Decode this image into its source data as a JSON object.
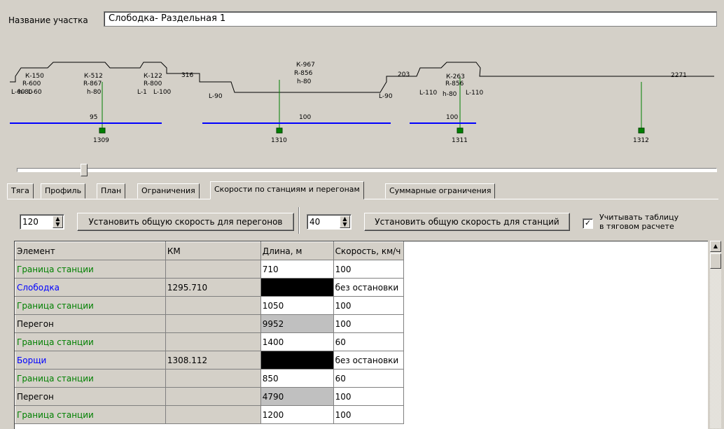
{
  "header": {
    "label": "Название участка",
    "value": "Слободка- Раздельная 1"
  },
  "scheme": {
    "group1": {
      "k": "К-150",
      "r": "R-600",
      "l": "L-60",
      "h": "h-80",
      "l2": "L-60"
    },
    "group2": {
      "k": "К-512",
      "r": "R-867",
      "h": "h-80"
    },
    "group3": {
      "k": "К-122",
      "r": "R-800",
      "l": "L-1",
      "l2": "L-100"
    },
    "len316": "316",
    "l90a": "L-90",
    "group4": {
      "k": "К-967",
      "r": "R-856",
      "h": "h-80"
    },
    "l90b": "L-90",
    "len203": "203",
    "group5": {
      "k": "К-263",
      "r": "R-856",
      "l": "L-110",
      "h": "h-80",
      "l2": "L-110"
    },
    "len2271": "2271",
    "speeds": [
      "95",
      "100",
      "100"
    ],
    "markers": [
      "1309",
      "1310",
      "1311",
      "1312"
    ],
    "colors": {
      "speed_line": "#0000ff",
      "marker": "#008000"
    }
  },
  "tabs": [
    {
      "label": "Тяга"
    },
    {
      "label": "Профиль"
    },
    {
      "label": "План"
    },
    {
      "label": "Ограничения"
    },
    {
      "label": "Скорости по станциям и перегонам",
      "active": true
    },
    {
      "label": "Суммарные ограничения"
    }
  ],
  "controls": {
    "haul_speed": "120",
    "haul_button": "Установить общую скорость для перегонов",
    "station_speed": "40",
    "station_button": "Установить общую скорость для станций",
    "checkbox_checked": true,
    "checkbox_label_1": "Учитывать таблицу",
    "checkbox_label_2": "в тяговом расчете"
  },
  "table": {
    "headers": [
      "Элемент",
      "КМ",
      "Длина, м",
      "Скорость, км/ч"
    ],
    "rows": [
      {
        "element": "Граница станции",
        "km": "",
        "length": "710",
        "speed": "100",
        "type": "border"
      },
      {
        "element": "Слободка",
        "km": "1295.710",
        "length": "",
        "speed": "без остановки",
        "type": "station"
      },
      {
        "element": "Граница станции",
        "km": "",
        "length": "1050",
        "speed": "100",
        "type": "border"
      },
      {
        "element": "Перегон",
        "km": "",
        "length": "9952",
        "speed": "100",
        "type": "haul"
      },
      {
        "element": "Граница станции",
        "km": "",
        "length": "1400",
        "speed": "60",
        "type": "border"
      },
      {
        "element": "Борщи",
        "km": "1308.112",
        "length": "",
        "speed": "без остановки",
        "type": "station"
      },
      {
        "element": "Граница станции",
        "km": "",
        "length": "850",
        "speed": "60",
        "type": "border"
      },
      {
        "element": "Перегон",
        "km": "",
        "length": "4790",
        "speed": "100",
        "type": "haul"
      },
      {
        "element": "Граница станции",
        "km": "",
        "length": "1200",
        "speed": "100",
        "type": "border"
      }
    ]
  }
}
